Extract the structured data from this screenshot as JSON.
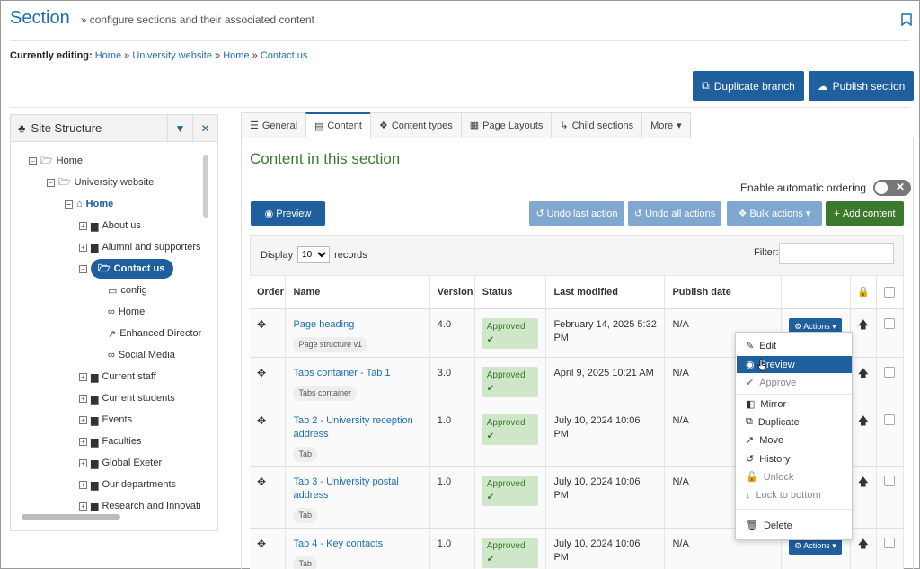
{
  "header": {
    "title": "Section",
    "subtitle": "» configure sections and their associated content",
    "editing_label": "Currently editing:",
    "breadcrumbs": [
      "Home",
      "University website",
      "Home",
      "Contact us"
    ],
    "sep": "»"
  },
  "buttons": {
    "duplicate_branch": "Duplicate branch",
    "publish_section": "Publish section"
  },
  "sidebar": {
    "title": "Site Structure",
    "nodes": [
      {
        "label": "Home"
      },
      {
        "label": "University website"
      },
      {
        "label": "Home"
      },
      {
        "label": "About us"
      },
      {
        "label": "Alumni and supporters"
      },
      {
        "label": "Contact us"
      },
      {
        "label": "config"
      },
      {
        "label": "Home"
      },
      {
        "label": "Enhanced Directory"
      },
      {
        "label": "Social Media"
      },
      {
        "label": "Current staff"
      },
      {
        "label": "Current students"
      },
      {
        "label": "Events"
      },
      {
        "label": "Faculties"
      },
      {
        "label": "Global Exeter"
      },
      {
        "label": "Our departments"
      },
      {
        "label": "Research and Innovation"
      }
    ]
  },
  "tabs": [
    {
      "label": "General"
    },
    {
      "label": "Content"
    },
    {
      "label": "Content types"
    },
    {
      "label": "Page Layouts"
    },
    {
      "label": "Child sections"
    },
    {
      "label": "More"
    }
  ],
  "content": {
    "title": "Content in this section",
    "auto_ordering_label": "Enable automatic ordering",
    "toggle_symbol": "✕",
    "preview": "Preview",
    "undo_last": "Undo last action",
    "undo_all": "Undo all actions",
    "bulk_actions": "Bulk actions",
    "add_content": "Add content",
    "display_label": "Display",
    "display_value": "10",
    "records_label": "records",
    "filter_label": "Filter:"
  },
  "table": {
    "headers": {
      "order": "Order",
      "name": "Name",
      "version": "Version",
      "status": "Status",
      "last_modified": "Last modified",
      "publish_date": "Publish date"
    },
    "rows": [
      {
        "name": "Page heading",
        "type": "Page structure v1",
        "version": "4.0",
        "status": "Approved",
        "modified": "February 14, 2025 5:32 PM",
        "publish": "N/A"
      },
      {
        "name": "Tabs container - Tab 1",
        "type": "Tabs container",
        "version": "3.0",
        "status": "Approved",
        "modified": "April 9, 2025 10:21 AM",
        "publish": "N/A"
      },
      {
        "name": "Tab 2 - University reception address",
        "type": "Tab",
        "version": "1.0",
        "status": "Approved",
        "modified": "July 10, 2024 10:06 PM",
        "publish": "N/A"
      },
      {
        "name": "Tab 3 - University postal address",
        "type": "Tab",
        "version": "1.0",
        "status": "Approved",
        "modified": "July 10, 2024 10:06 PM",
        "publish": "N/A"
      },
      {
        "name": "Tab 4 - Key contacts",
        "type": "Tab",
        "version": "1.0",
        "status": "Approved",
        "modified": "July 10, 2024 10:06 PM",
        "publish": "N/A"
      }
    ],
    "actions_label": "Actions"
  },
  "menu": {
    "items": [
      "Edit",
      "Preview",
      "Approve",
      "Mirror",
      "Duplicate",
      "Move",
      "History",
      "Unlock",
      "Lock to bottom",
      "Delete"
    ]
  },
  "colors": {
    "primary": "#1f5f9e",
    "green": "#3b7a2d",
    "light_blue": "#7fa7d0"
  }
}
